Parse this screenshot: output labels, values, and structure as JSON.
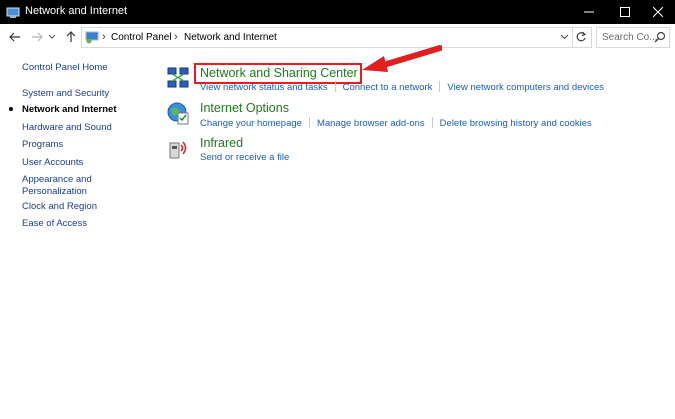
{
  "window": {
    "title": "Network and Internet"
  },
  "address": {
    "crumbs": [
      "Control Panel",
      "Network and Internet"
    ],
    "search_placeholder": "Search Co..."
  },
  "sidebar": {
    "items": [
      {
        "label": "Control Panel Home"
      },
      {
        "label": "System and Security"
      },
      {
        "label": "Network and Internet"
      },
      {
        "label": "Hardware and Sound"
      },
      {
        "label": "Programs"
      },
      {
        "label": "User Accounts"
      },
      {
        "label": "Appearance and Personalization"
      },
      {
        "label": "Clock and Region"
      },
      {
        "label": "Ease of Access"
      }
    ]
  },
  "categories": [
    {
      "title": "Network and Sharing Center",
      "tasks": [
        "View network status and tasks",
        "Connect to a network",
        "View network computers and devices"
      ]
    },
    {
      "title": "Internet Options",
      "tasks": [
        "Change your homepage",
        "Manage browser add-ons",
        "Delete browsing history and cookies"
      ]
    },
    {
      "title": "Infrared",
      "tasks": [
        "Send or receive a file"
      ]
    }
  ],
  "colors": {
    "titlebar": "#000000",
    "link": "#1a5fb4",
    "category_title": "#1e7a1e",
    "annotation": "#e31e1e"
  }
}
